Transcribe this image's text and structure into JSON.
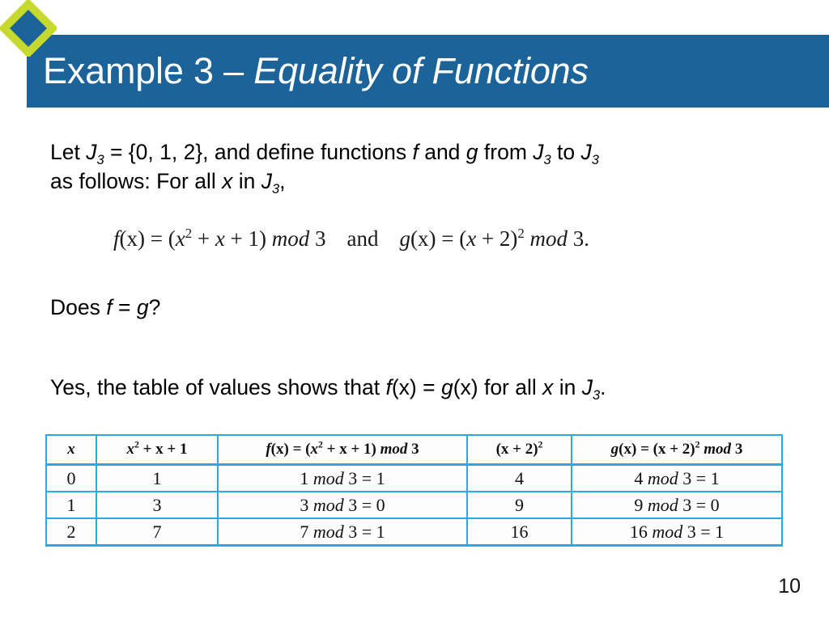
{
  "slide": {
    "title_plain": "Example 3 – ",
    "title_italic": "Equality of Functions",
    "page_number": "10",
    "banner_color": "#1B6399",
    "diamond_outline_color": "#C6D92E",
    "diamond_fill_color": "#1B6399",
    "table_border_color": "#29ABE2"
  },
  "body": {
    "intro_1_a": "Let ",
    "intro_1_J": "J",
    "intro_1_sub": "3",
    "intro_1_b": " = {0, 1, 2}, and define functions ",
    "intro_1_f": "f",
    "intro_1_c": " and ",
    "intro_1_g": "g",
    "intro_1_d": " from ",
    "intro_1_J2": "J",
    "intro_1_sub2": "3",
    "intro_1_e": " to ",
    "intro_1_J3": "J",
    "intro_1_sub3": "3",
    "intro_2_a": "as follows: For all ",
    "intro_2_x": "x",
    "intro_2_b": " in ",
    "intro_2_J": "J",
    "intro_2_sub": "3",
    "intro_2_c": ",",
    "does_a": "Does ",
    "does_f": "f",
    "does_eq": " = ",
    "does_g": "g",
    "does_q": "?",
    "yes_a": "Yes, the table of values shows that ",
    "yes_f": "f",
    "yes_fx": "(x)",
    "yes_eq": " = ",
    "yes_g": "g",
    "yes_gx": "(x)",
    "yes_b": " for all ",
    "yes_x": "x",
    "yes_c": " in ",
    "yes_J": "J",
    "yes_sub": "3",
    "yes_d": "."
  },
  "formula": {
    "f_name": "f",
    "f_arg": "(x)",
    "f_eq": " = (",
    "f_x": "x",
    "f_pow": "2",
    "f_mid": " + ",
    "f_x2": "x",
    "f_tail": " + 1) ",
    "f_mod": "mod",
    "f_three": " 3",
    "and": "and",
    "g_name": "g",
    "g_arg": "(x)",
    "g_eq": " = (",
    "g_x": "x",
    "g_plus": " + 2)",
    "g_pow": "2",
    "g_space": " ",
    "g_mod": "mod",
    "g_three": " 3."
  },
  "table": {
    "headers": [
      {
        "h_x": "x"
      },
      {
        "h2_x": "x",
        "h2_pow": "2",
        "h2_rest": " + x + 1"
      },
      {
        "h3_f": "f",
        "h3_arg": "(x)",
        "h3_eq": " = (",
        "h3_x": "x",
        "h3_pow": "2",
        "h3_rest": " + x + 1) ",
        "h3_mod": "mod",
        "h3_three": " 3"
      },
      {
        "h4_open": "(x + 2)",
        "h4_pow": "2"
      },
      {
        "h5_g": "g",
        "h5_arg": "(x)",
        "h5_eq": " = (x + 2)",
        "h5_pow": "2",
        "h5_space": " ",
        "h5_mod": "mod",
        "h5_three": " 3"
      }
    ],
    "rows": [
      {
        "x": "0",
        "quad": "1",
        "f_num": "1 ",
        "f_mod": "mod",
        "f_res": " 3 = 1",
        "sq": "4",
        "g_num": "4 ",
        "g_mod": "mod",
        "g_res": " 3 = 1"
      },
      {
        "x": "1",
        "quad": "3",
        "f_num": "3 ",
        "f_mod": "mod",
        "f_res": " 3 = 0",
        "sq": "9",
        "g_num": "9 ",
        "g_mod": "mod",
        "g_res": " 3 = 0"
      },
      {
        "x": "2",
        "quad": "7",
        "f_num": "7 ",
        "f_mod": "mod",
        "f_res": " 3 = 1",
        "sq": "16",
        "g_num": "16 ",
        "g_mod": "mod",
        "g_res": " 3 = 1"
      }
    ]
  }
}
